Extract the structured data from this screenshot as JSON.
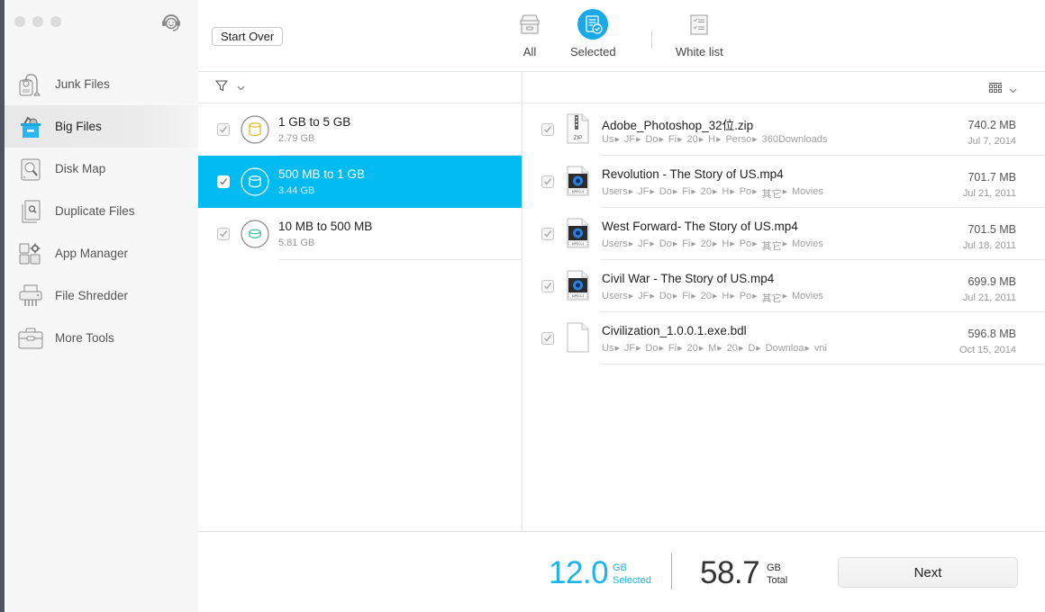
{
  "window": {
    "traffic_lights": [
      "close",
      "minimize",
      "zoom"
    ]
  },
  "sidebar": {
    "support_icon": "support-headset-icon",
    "items": [
      {
        "label": "Junk Files",
        "icon": "vacuum-icon",
        "active": false
      },
      {
        "label": "Big Files",
        "icon": "big-files-box-icon",
        "active": true
      },
      {
        "label": "Disk Map",
        "icon": "disk-map-icon",
        "active": false
      },
      {
        "label": "Duplicate Files",
        "icon": "duplicate-files-icon",
        "active": false
      },
      {
        "label": "App Manager",
        "icon": "app-manager-icon",
        "active": false
      },
      {
        "label": "File Shredder",
        "icon": "shredder-icon",
        "active": false
      },
      {
        "label": "More Tools",
        "icon": "toolbox-icon",
        "active": false
      }
    ]
  },
  "header": {
    "start_over_label": "Start Over",
    "tabs": [
      {
        "label": "All",
        "icon": "archive-box-icon",
        "active": false
      },
      {
        "label": "Selected",
        "icon": "selected-list-icon",
        "active": true
      },
      {
        "label": "White list",
        "icon": "white-list-icon",
        "active": false
      }
    ]
  },
  "colors": {
    "accent": "#00bbef",
    "selected_number": "#1ab4ea",
    "category_1gb_5gb": "#e8b830",
    "category_500mb_1gb": "#ffffff",
    "category_10mb_500mb": "#3cc49a"
  },
  "categories": [
    {
      "name": "1 GB to 5 GB",
      "size": "2.79 GB",
      "checked": true,
      "selected": false
    },
    {
      "name": "500 MB to 1 GB",
      "size": "3.44 GB",
      "checked": true,
      "selected": true
    },
    {
      "name": "10 MB to 500 MB",
      "size": "5.81 GB",
      "checked": true,
      "selected": false
    }
  ],
  "files": [
    {
      "name": "Adobe_Photoshop_32位.zip",
      "type": "zip",
      "path": [
        "Us",
        "JF",
        "Do",
        "Fi",
        "20",
        "H",
        "Perso",
        "360Downloads"
      ],
      "size": "740.2 MB",
      "date": "Jul 7, 2014",
      "checked": true
    },
    {
      "name": "Revolution - The Story of US.mp4",
      "type": "mpeg",
      "path": [
        "Users",
        "JF",
        "Do",
        "Fi",
        "20",
        "H",
        "Po",
        "其它",
        "Movies"
      ],
      "size": "701.7 MB",
      "date": "Jul 21, 2011",
      "checked": true
    },
    {
      "name": "West Forward- The Story of US.mp4",
      "type": "mpeg",
      "path": [
        "Users",
        "JF",
        "Do",
        "Fi",
        "20",
        "H",
        "Po",
        "其它",
        "Movies"
      ],
      "size": "701.5 MB",
      "date": "Jul 18, 2011",
      "checked": true
    },
    {
      "name": "Civil War - The Story of US.mp4",
      "type": "mpeg",
      "path": [
        "Users",
        "JF",
        "Do",
        "Fi",
        "20",
        "H",
        "Po",
        "其它",
        "Movies"
      ],
      "size": "699.9 MB",
      "date": "Jul 21, 2011",
      "checked": true
    },
    {
      "name": "Civilization_1.0.0.1.exe.bdl",
      "type": "generic",
      "path": [
        "Us",
        "JF",
        "Do",
        "Fi",
        "20",
        "M",
        "20",
        "D",
        "Downloa",
        "vni"
      ],
      "size": "596.8 MB",
      "date": "Oct 15, 2014",
      "checked": true
    }
  ],
  "footer": {
    "selected_value": "12.0",
    "selected_unit": "GB",
    "selected_label": "Selected",
    "total_value": "58.7",
    "total_unit": "GB",
    "total_label": "Total",
    "next_label": "Next"
  }
}
